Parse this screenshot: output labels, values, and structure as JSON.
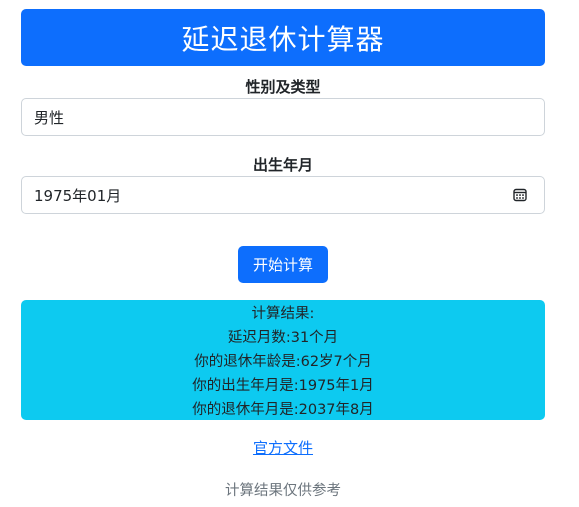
{
  "header": {
    "title": "延迟退休计算器"
  },
  "form": {
    "gender_label": "性别及类型",
    "gender_value": "男性",
    "birth_label": "出生年月",
    "birth_value": "1975年01月",
    "calendar_icon": "calendar-icon",
    "submit_label": "开始计算"
  },
  "result": {
    "lines": [
      "计算结果:",
      "延迟月数:31个月",
      "你的退休年龄是:62岁7个月",
      "你的出生年月是:1975年1月",
      "你的退休年月是:2037年8月"
    ]
  },
  "footer": {
    "doc_link": "官方文件",
    "note": "计算结果仅供参考"
  },
  "colors": {
    "primary": "#0d6efd",
    "result_bg": "#0dcaf0",
    "muted": "#6c757d"
  }
}
